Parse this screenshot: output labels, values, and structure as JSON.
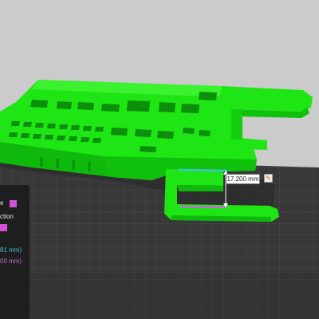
{
  "measurement": {
    "distance_label": "17.200 mm",
    "edit_icon": "pencil-edit-icon"
  },
  "side_panel": {
    "row1_text": "e",
    "row2_text": "ction",
    "mm_line_1": "81 mm)",
    "mm_line_2": "00 mm)",
    "swatch_color": "#d44fd6"
  },
  "colors": {
    "model_green": "#18e010",
    "model_green_dark": "#0a9a08",
    "bed_dark": "#3a3a3a",
    "background_light": "#c9c9c9",
    "measure_cyan": "#41c3d1",
    "measure_magenta": "#c66ad6"
  }
}
